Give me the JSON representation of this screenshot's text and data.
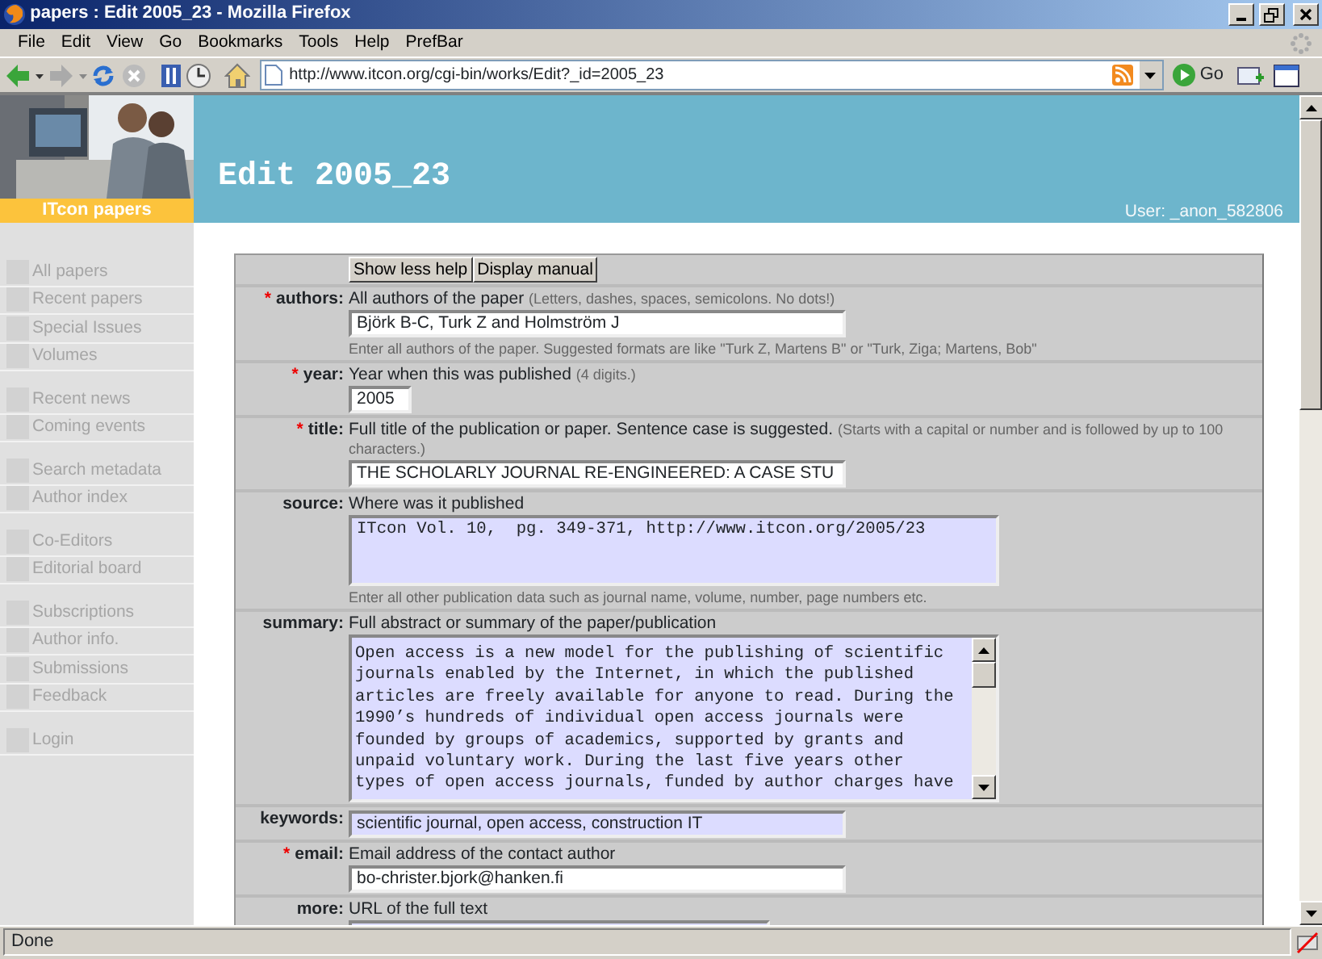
{
  "window": {
    "title": "papers : Edit 2005_23 - Mozilla Firefox"
  },
  "menu": [
    "File",
    "Edit",
    "View",
    "Go",
    "Bookmarks",
    "Tools",
    "Help",
    "PrefBar"
  ],
  "toolbar": {
    "address": "http://www.itcon.org/cgi-bin/works/Edit?_id=2005_23",
    "go_label": "Go"
  },
  "header": {
    "brand": "ITcon papers",
    "title": "Edit 2005_23",
    "user": "User: _anon_582806"
  },
  "sidebar": {
    "groups": [
      {
        "items": [
          "All papers",
          "Recent papers",
          "Special Issues",
          "Volumes"
        ]
      },
      {
        "items": [
          "Recent news",
          "Coming events"
        ]
      },
      {
        "items": [
          "Search metadata",
          "Author index"
        ]
      },
      {
        "items": [
          "Co-Editors",
          "Editorial board"
        ]
      },
      {
        "items": [
          "Subscriptions",
          "Author info.",
          "Submissions",
          "Feedback"
        ]
      },
      {
        "items": [
          "Login"
        ]
      }
    ]
  },
  "form": {
    "buttons": [
      "Show less help",
      "Display manual"
    ],
    "fields": [
      {
        "marker": "*",
        "label": "authors:",
        "help": "All authors of the paper",
        "note": "(Letters, dashes, spaces, semicolons. No dots!)",
        "kind": "line",
        "highlighted": false,
        "value": "Björk B-C, Turk Z and Holmström J",
        "hint": "Enter all authors of the paper. Suggested formats are like \"Turk Z, Martens B\" or \"Turk, Ziga; Martens, Bob\""
      },
      {
        "marker": "*",
        "label": "year:",
        "help": "Year when this was published",
        "note": "(4 digits.)",
        "kind": "short",
        "highlighted": false,
        "value": "2005"
      },
      {
        "marker": "*",
        "label": "title:",
        "help": "Full title of the publication or paper. Sentence case is suggested.",
        "note": "(Starts with a capital or number and is followed by up to 100 characters.)",
        "kind": "line",
        "highlighted": false,
        "value": "THE SCHOLARLY JOURNAL RE-ENGINEERED: A CASE STU"
      },
      {
        "label": "source:",
        "help": "Where was it published",
        "kind": "box",
        "highlighted": true,
        "value": "ITcon Vol. 10,  pg. 349-371, http://www.itcon.org/2005/23",
        "hint": "Enter all other publication data such as journal name, volume, number, page numbers etc."
      },
      {
        "label": "summary:",
        "help": "Full abstract or summary of the paper/publication",
        "kind": "scrollbox",
        "highlighted": true,
        "value": "Open access is a new model for the publishing of scientific\njournals enabled by the Internet, in which the published\narticles are freely available for anyone to read. During the\n1990’s hundreds of individual open access journals were\nfounded by groups of academics, supported by grants and\nunpaid voluntary work. During the last five years other\ntypes of open access journals, funded by author charges have"
      },
      {
        "label": "keywords:",
        "kind": "line",
        "highlighted": true,
        "value": "scientific journal, open access, construction IT"
      },
      {
        "marker": "*",
        "label": "email:",
        "help": "Email address of the contact author",
        "kind": "line",
        "highlighted": false,
        "value": "bo-christer.bjork@hanken.fi"
      },
      {
        "label": "more:",
        "help": "URL of the full text",
        "kind": "medium",
        "highlighted": true
      }
    ]
  },
  "status_bar": {
    "text": "Done"
  }
}
